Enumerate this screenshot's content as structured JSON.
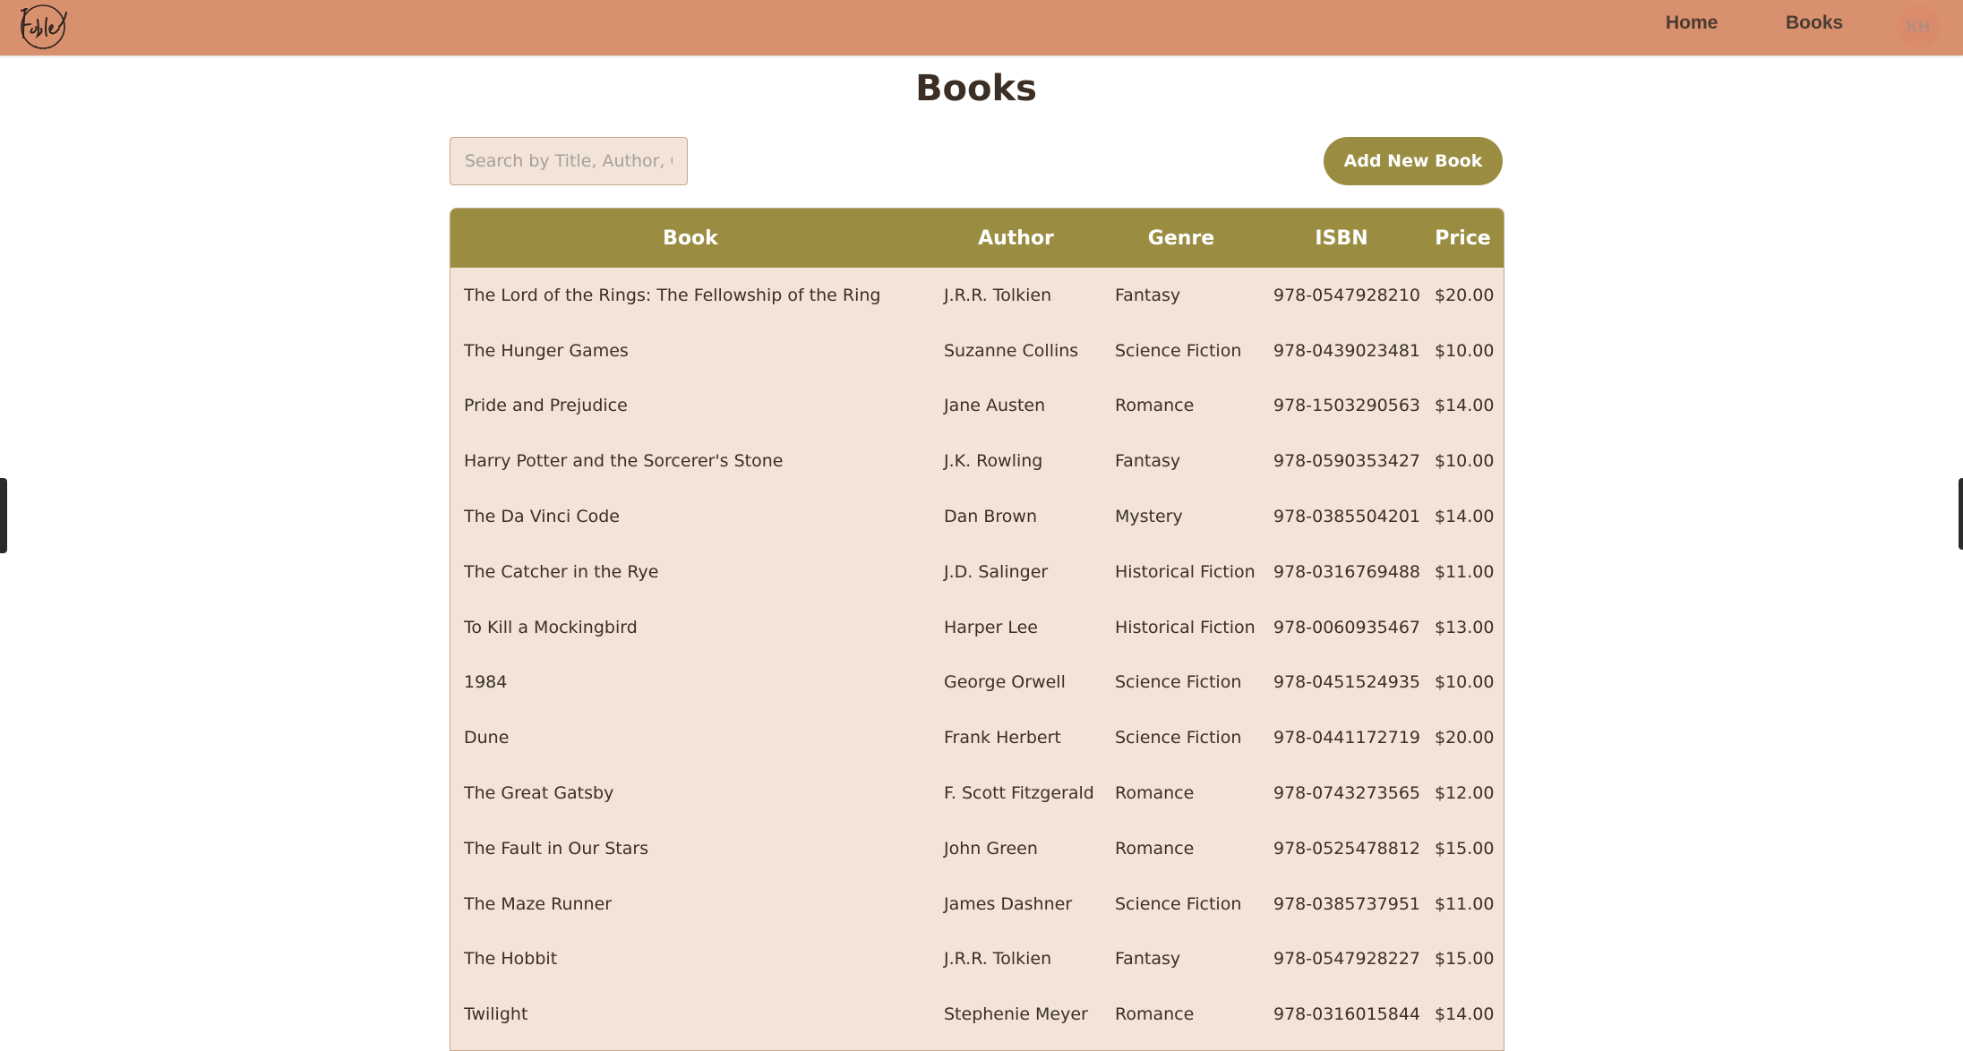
{
  "nav": {
    "home": "Home",
    "books": "Books",
    "avatar_initials": "KH"
  },
  "page": {
    "title": "Books"
  },
  "search": {
    "placeholder": "Search by Title, Author, Genre",
    "value": ""
  },
  "toolbar": {
    "add_label": "Add New Book"
  },
  "colors": {
    "topbar": "#d8906e",
    "accent": "#9a8d42",
    "table_bg": "#f2e4d8"
  },
  "table": {
    "headers": {
      "book": "Book",
      "author": "Author",
      "genre": "Genre",
      "isbn": "ISBN",
      "price": "Price"
    },
    "rows": [
      {
        "book": "The Lord of the Rings: The Fellowship of the Ring",
        "author": "J.R.R. Tolkien",
        "genre": "Fantasy",
        "isbn": "978-0547928210",
        "price": "$20.00"
      },
      {
        "book": "The Hunger Games",
        "author": "Suzanne Collins",
        "genre": "Science Fiction",
        "isbn": "978-0439023481",
        "price": "$10.00"
      },
      {
        "book": "Pride and Prejudice",
        "author": "Jane Austen",
        "genre": "Romance",
        "isbn": "978-1503290563",
        "price": "$14.00"
      },
      {
        "book": "Harry Potter and the Sorcerer's Stone",
        "author": "J.K. Rowling",
        "genre": "Fantasy",
        "isbn": "978-0590353427",
        "price": "$10.00"
      },
      {
        "book": "The Da Vinci Code",
        "author": "Dan Brown",
        "genre": "Mystery",
        "isbn": "978-0385504201",
        "price": "$14.00"
      },
      {
        "book": "The Catcher in the Rye",
        "author": "J.D. Salinger",
        "genre": "Historical Fiction",
        "isbn": "978-0316769488",
        "price": "$11.00"
      },
      {
        "book": "To Kill a Mockingbird",
        "author": "Harper Lee",
        "genre": "Historical Fiction",
        "isbn": "978-0060935467",
        "price": "$13.00"
      },
      {
        "book": "1984",
        "author": "George Orwell",
        "genre": "Science Fiction",
        "isbn": "978-0451524935",
        "price": "$10.00"
      },
      {
        "book": "Dune",
        "author": "Frank Herbert",
        "genre": "Science Fiction",
        "isbn": "978-0441172719",
        "price": "$20.00"
      },
      {
        "book": "The Great Gatsby",
        "author": "F. Scott Fitzgerald",
        "genre": "Romance",
        "isbn": "978-0743273565",
        "price": "$12.00"
      },
      {
        "book": "The Fault in Our Stars",
        "author": "John Green",
        "genre": "Romance",
        "isbn": "978-0525478812",
        "price": "$15.00"
      },
      {
        "book": "The Maze Runner",
        "author": "James Dashner",
        "genre": "Science Fiction",
        "isbn": "978-0385737951",
        "price": "$11.00"
      },
      {
        "book": "The Hobbit",
        "author": "J.R.R. Tolkien",
        "genre": "Fantasy",
        "isbn": "978-0547928227",
        "price": "$15.00"
      },
      {
        "book": "Twilight",
        "author": "Stephenie Meyer",
        "genre": "Romance",
        "isbn": "978-0316015844",
        "price": "$14.00"
      }
    ]
  }
}
